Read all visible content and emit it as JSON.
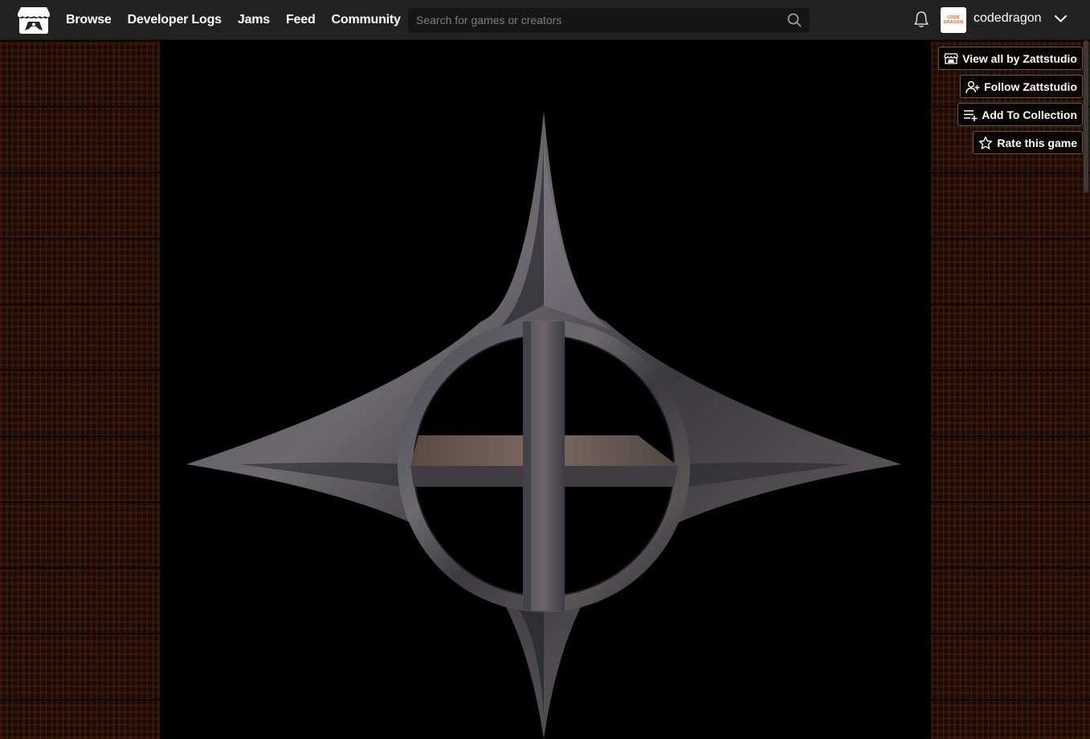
{
  "header": {
    "nav": [
      "Browse",
      "Developer Logs",
      "Jams",
      "Feed",
      "Community"
    ],
    "search_placeholder": "Search for games or creators",
    "username": "codedragon",
    "avatar_text": [
      "CODE",
      "DRAGON"
    ]
  },
  "actions": {
    "view_all": "View all by Zattstudio",
    "follow": "Follow Zattstudio",
    "add_collection": "Add To Collection",
    "rate": "Rate this game"
  },
  "colors": {
    "header_bg": "#222222",
    "page_bg": "#1b0b05",
    "stage_bg": "#000000",
    "avatar_text": "#ff6a2a"
  },
  "icons": [
    "itchio-logo-icon",
    "search-icon",
    "bell-icon",
    "chevron-down-icon",
    "store-icon",
    "user-plus-icon",
    "playlist-add-icon",
    "star-icon"
  ]
}
